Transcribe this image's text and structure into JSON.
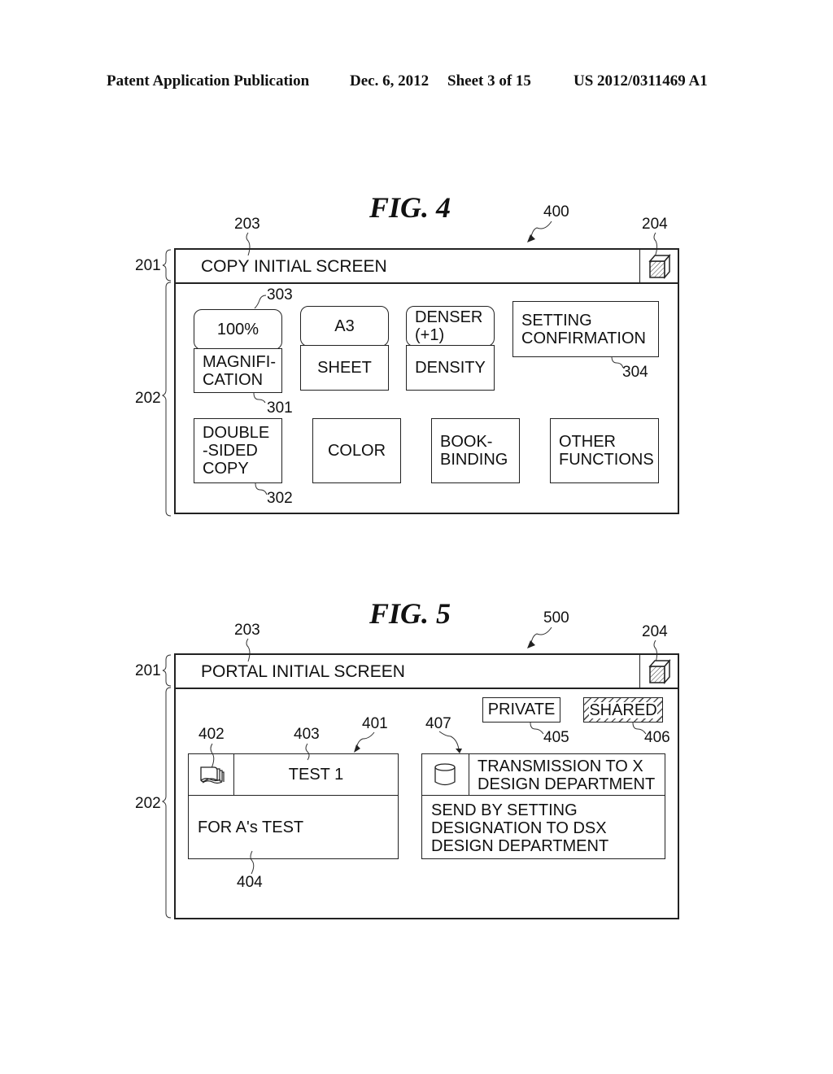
{
  "header": {
    "publication": "Patent Application Publication",
    "date": "Dec. 6, 2012",
    "sheet": "Sheet 3 of 15",
    "number": "US 2012/0311469 A1"
  },
  "fig4": {
    "title": "FIG. 4",
    "refs": {
      "screen": "400",
      "title_area": "203",
      "close_icon": "204",
      "bar": "201",
      "body": "202",
      "value_key": "303",
      "label_key": "301",
      "double_sided": "302",
      "confirm": "304"
    },
    "screen_title": "COPY INITIAL SCREEN",
    "settings": [
      {
        "value": "100%",
        "label_line1": "MAGNIFI-",
        "label_line2": "CATION"
      },
      {
        "value": "A3",
        "label_line1": "SHEET",
        "label_line2": ""
      },
      {
        "value_line1": "DENSER",
        "value_line2": "(+1)",
        "label_line1": "DENSITY",
        "label_line2": ""
      }
    ],
    "confirm_button": {
      "line1": "SETTING",
      "line2": "CONFIRMATION"
    },
    "function_buttons": [
      {
        "line1": "DOUBLE",
        "line2": "-SIDED",
        "line3": "COPY"
      },
      {
        "line1": "COLOR"
      },
      {
        "line1": "BOOK-",
        "line2": "BINDING"
      },
      {
        "line1": "OTHER",
        "line2": "FUNCTIONS"
      }
    ]
  },
  "fig5": {
    "title": "FIG. 5",
    "refs": {
      "screen": "500",
      "title_area": "203",
      "close_icon": "204",
      "bar": "201",
      "body": "202",
      "card1": "401",
      "card1_icon": "402",
      "card1_title": "403",
      "card1_desc": "404",
      "private": "405",
      "shared": "406",
      "card2": "407"
    },
    "screen_title": "PORTAL INITIAL SCREEN",
    "filters": {
      "private": "PRIVATE",
      "shared": "SHARED"
    },
    "cards": [
      {
        "icon": "documents-icon",
        "title": "TEST 1",
        "description": "FOR A's TEST"
      },
      {
        "icon": "database-icon",
        "title_line1": "TRANSMISSION TO X",
        "title_line2": "DESIGN DEPARTMENT",
        "desc_line1": "SEND BY SETTING",
        "desc_line2": "DESIGNATION TO DSX",
        "desc_line3": "DESIGN DEPARTMENT"
      }
    ]
  }
}
